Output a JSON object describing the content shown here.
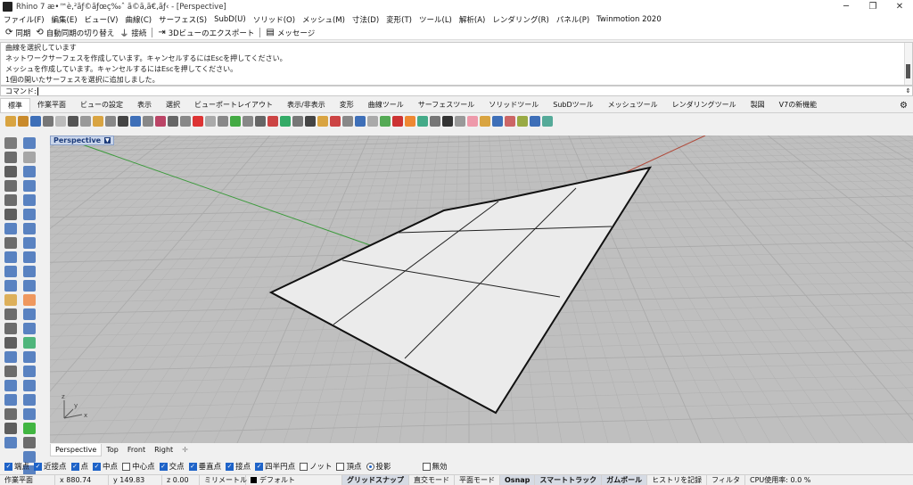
{
  "window": {
    "title": "Rhino 7 æ•™è‚²ãƒ©ãƒœç‰ˆ ã©ã‚ã€‚ãƒ‹ - [Perspective]",
    "minimize": "─",
    "restore": "❐",
    "close": "✕"
  },
  "menu": [
    "ファイル(F)",
    "編集(E)",
    "ビュー(V)",
    "曲線(C)",
    "サーフェス(S)",
    "SubD(U)",
    "ソリッド(O)",
    "メッシュ(M)",
    "寸法(D)",
    "変形(T)",
    "ツール(L)",
    "解析(A)",
    "レンダリング(R)",
    "パネル(P)",
    "Twinmotion 2020"
  ],
  "commandbar": {
    "sync": "同期",
    "auto_sync": "自動同期の切り替え",
    "connect": "接続",
    "export_3d": "3Dビューのエクスポート",
    "message": "メッセージ"
  },
  "history": [
    "曲線を選択しています",
    "ネットワークサーフェスを作成しています。キャンセルするにはEscを押してください。",
    "メッシュを作成しています。キャンセルするにはEscを押してください。",
    "1個の開いたサーフェスを選択に追加しました。"
  ],
  "prompt": {
    "label": "コマンド:"
  },
  "tabs": [
    "標準",
    "作業平面",
    "ビューの設定",
    "表示",
    "選択",
    "ビューポートレイアウト",
    "表示/非表示",
    "変形",
    "曲線ツール",
    "サーフェスツール",
    "ソリッドツール",
    "SubDツール",
    "メッシュツール",
    "レンダリングツール",
    "製図",
    "V7の新機能"
  ],
  "toolbar_icon_colors": [
    "#d9a441",
    "#c98a2b",
    "#3e6fb8",
    "#777",
    "#bbb",
    "#555",
    "#999",
    "#d9a441",
    "#888",
    "#444",
    "#3e6fb8",
    "#888",
    "#b46",
    "#666",
    "#888",
    "#d33",
    "#aaa",
    "#888",
    "#4a4",
    "#888",
    "#666",
    "#c44",
    "#3a6",
    "#777",
    "#444",
    "#d9a441",
    "#c44",
    "#888",
    "#3e6fb8",
    "#aaa",
    "#5a5",
    "#c33",
    "#e83",
    "#4a8",
    "#777",
    "#333",
    "#999",
    "#e9a",
    "#d9a441",
    "#3e6fb8",
    "#c66",
    "#9a4",
    "#3e6fb8",
    "#5a9"
  ],
  "toolbox_icon_colors": [
    "#666",
    "#3e6fb8",
    "#555",
    "#999",
    "#444",
    "#3e6fb8",
    "#555",
    "#3e6fb8",
    "#555",
    "#3e6fb8",
    "#444",
    "#3e6fb8",
    "#3e6fb8",
    "#3e6fb8",
    "#555",
    "#3e6fb8",
    "#3e6fb8",
    "#3e6fb8",
    "#3e6fb8",
    "#3e6fb8",
    "#3e6fb8",
    "#3e6fb8",
    "#d9a441",
    "#e84",
    "#555",
    "#3e6fb8",
    "#555",
    "#3e6fb8",
    "#444",
    "#3a6",
    "#3e6fb8",
    "#3e6fb8",
    "#555",
    "#3e6fb8",
    "#3e6fb8",
    "#3e6fb8",
    "#3e6fb8",
    "#3e6fb8",
    "#555",
    "#3e6fb8",
    "#444",
    "#2a2",
    "#3e6fb8",
    "#555",
    "#fff",
    "#3e6fb8",
    "#fff",
    "#3e6fb8",
    "#fff",
    "#3e6fb8"
  ],
  "toolbox_more": "»",
  "viewport": {
    "label": "Perspective",
    "dropdown": "▼",
    "background": "#bfbfbf",
    "grid_color": "#ababab",
    "x_axis_color": "#b04a3a",
    "y_axis_color": "#3c9a3c",
    "surface_fill": "#ebebeb",
    "gizmo": {
      "x": "x",
      "y": "y",
      "z": "z"
    }
  },
  "viewport_tabs": [
    "Perspective",
    "Top",
    "Front",
    "Right"
  ],
  "viewport_tabs_add": "✛",
  "osnap": [
    {
      "label": "端点",
      "checked": true
    },
    {
      "label": "近接点",
      "checked": true
    },
    {
      "label": "点",
      "checked": true
    },
    {
      "label": "中点",
      "checked": true
    },
    {
      "label": "中心点",
      "checked": false
    },
    {
      "label": "交点",
      "checked": true
    },
    {
      "label": "垂直点",
      "checked": true
    },
    {
      "label": "接点",
      "checked": true
    },
    {
      "label": "四半円点",
      "checked": true
    },
    {
      "label": "ノット",
      "checked": false
    },
    {
      "label": "頂点",
      "checked": false
    }
  ],
  "project_label": "投影",
  "disable_label": "無効",
  "status": {
    "cplane": "作業平面",
    "x": "x 880.74",
    "y": "y 149.83",
    "z": "z 0.00",
    "units": "ミリメートル",
    "layer": "デフォルト",
    "grid_snap": "グリッドスナップ",
    "ortho": "直交モード",
    "planar": "平面モード",
    "osnap": "Osnap",
    "smarttrack": "スマートトラック",
    "gumball": "ガムボール",
    "history": "ヒストリを記録",
    "filter": "フィルタ",
    "cpu": "CPU使用率: 0.0 %"
  }
}
